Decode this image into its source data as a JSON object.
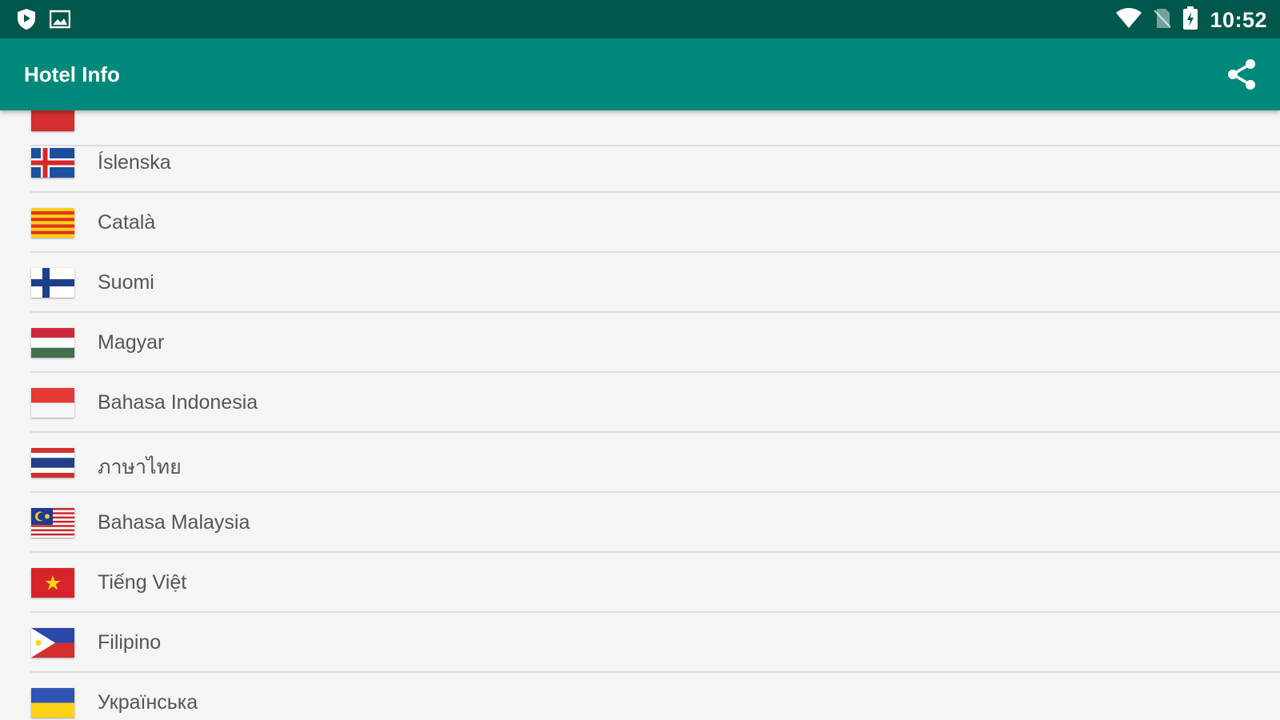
{
  "status_bar": {
    "time": "10:52",
    "left_icons": [
      "shield-icon",
      "image-icon"
    ],
    "right_icons": [
      "wifi-icon",
      "no-sim-icon",
      "battery-charging-icon"
    ]
  },
  "app_bar": {
    "title": "Hotel Info",
    "action_icon": "share-icon"
  },
  "languages": [
    {
      "label": "Íslenska",
      "flag": "iceland-flag"
    },
    {
      "label": "Català",
      "flag": "catalonia-flag"
    },
    {
      "label": "Suomi",
      "flag": "finland-flag"
    },
    {
      "label": "Magyar",
      "flag": "hungary-flag"
    },
    {
      "label": "Bahasa Indonesia",
      "flag": "indonesia-flag"
    },
    {
      "label": "ภาษาไทย",
      "flag": "thailand-flag"
    },
    {
      "label": "Bahasa Malaysia",
      "flag": "malaysia-flag"
    },
    {
      "label": "Tiếng Việt",
      "flag": "vietnam-flag"
    },
    {
      "label": "Filipino",
      "flag": "philippines-flag"
    },
    {
      "label": "Українська",
      "flag": "ukraine-flag"
    }
  ],
  "colors": {
    "status_bar": "#00574b",
    "app_bar": "#00897b",
    "background": "#f5f5f5"
  }
}
